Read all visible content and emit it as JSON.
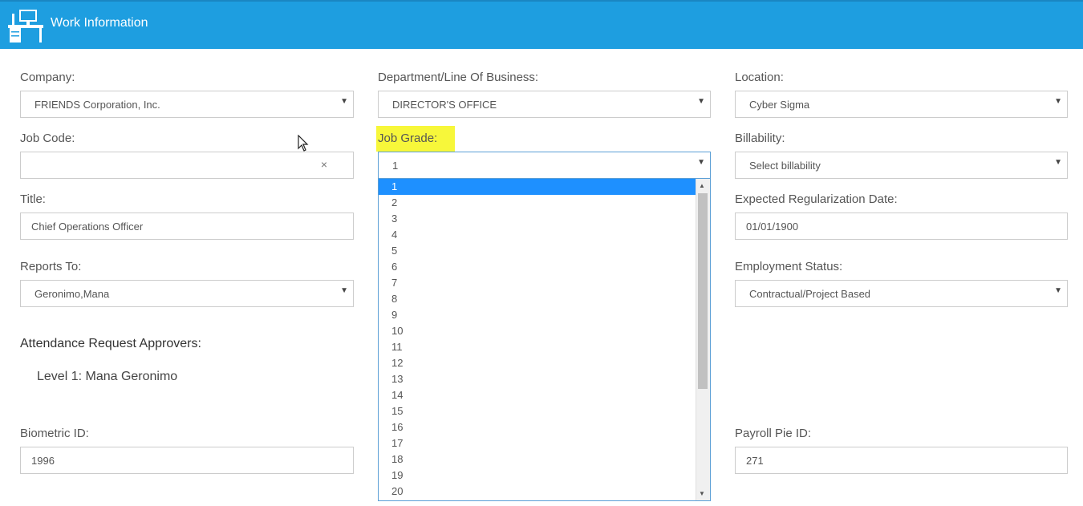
{
  "header": {
    "title": "Work Information",
    "icon": "desk-computer-icon"
  },
  "fields": {
    "company": {
      "label": "Company:",
      "value": "FRIENDS Corporation, Inc."
    },
    "department": {
      "label": "Department/Line Of Business:",
      "value": "DIRECTOR'S OFFICE"
    },
    "location": {
      "label": "Location:",
      "value": "Cyber Sigma"
    },
    "job_code": {
      "label": "Job Code:",
      "value": "",
      "clear": "×"
    },
    "job_grade": {
      "label": "Job Grade:",
      "value": "1",
      "highlight_color": "#f7f73a"
    },
    "billability": {
      "label": "Billability:",
      "value": "Select billability"
    },
    "title": {
      "label": "Title:",
      "value": "Chief Operations Officer"
    },
    "regularization": {
      "label": "Expected Regularization Date:",
      "value": "01/01/1900"
    },
    "reports_to": {
      "label": "Reports To:",
      "value": "Geronimo,Mana"
    },
    "employment_status": {
      "label": "Employment Status:",
      "value": "Contractual/Project Based"
    },
    "biometric_id": {
      "label": "Biometric ID:",
      "value": "1996"
    },
    "payroll_pie_id": {
      "label": "Payroll Pie ID:",
      "value": "271"
    }
  },
  "approvers": {
    "title": "Attendance Request Approvers:",
    "level1": "Level 1: Mana Geronimo"
  },
  "job_grade_options": [
    "1",
    "2",
    "3",
    "4",
    "5",
    "6",
    "7",
    "8",
    "9",
    "10",
    "11",
    "12",
    "13",
    "14",
    "15",
    "16",
    "17",
    "18",
    "19",
    "20"
  ],
  "colors": {
    "header": "#1e9ee0",
    "selected_option": "#1e90ff"
  }
}
